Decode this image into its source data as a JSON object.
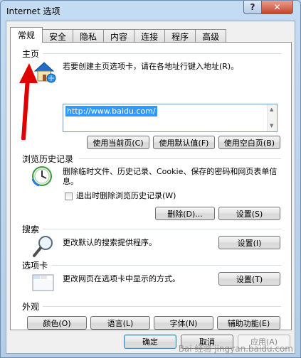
{
  "window": {
    "title": "Internet 选项",
    "help": "?",
    "close": "✕"
  },
  "tabs": [
    "常规",
    "安全",
    "隐私",
    "内容",
    "连接",
    "程序",
    "高级"
  ],
  "home": {
    "label": "主页",
    "description": "若要创建主页选项卡，请在各地址行键入地址(R)。",
    "url": "http://www.baidu.com/",
    "buttons": {
      "current": "使用当前页(C)",
      "default": "使用默认值(F)",
      "blank": "使用空白页(B)"
    }
  },
  "history": {
    "label": "浏览历史记录",
    "description": "删除临时文件、历史记录、Cookie、保存的密码和网页表单信息。",
    "checkbox_label": "退出时删除浏览历史记录(W)",
    "checkbox_checked": false,
    "buttons": {
      "delete": "删除(D)...",
      "settings": "设置(S)"
    }
  },
  "search": {
    "label": "搜索",
    "description": "更改默认的搜索提供程序。",
    "settings": "设置(I)"
  },
  "tabs_section": {
    "label": "选项卡",
    "description": "更改网页在选项卡中显示的方式。",
    "settings": "设置(T)"
  },
  "appearance": {
    "label": "外观",
    "buttons": {
      "colors": "颜色(O)",
      "languages": "语言(L)",
      "fonts": "字体(N)",
      "accessibility": "辅助功能(E)"
    }
  },
  "footer": {
    "ok": "确定",
    "cancel": "取消",
    "apply": "应用(A)"
  },
  "watermark": "Bai 经验 jingyan.baidu.com",
  "colors": {
    "arrow": "#e00000",
    "selection": "#3399ff"
  }
}
